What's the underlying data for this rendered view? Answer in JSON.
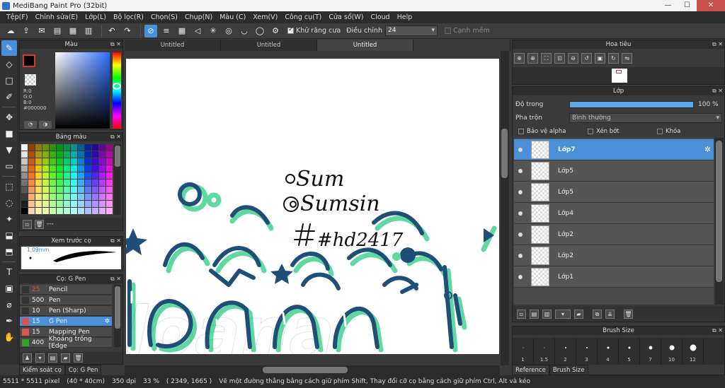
{
  "window": {
    "title": "MediBang Paint Pro (32bit)"
  },
  "menu": [
    "Tệp(F)",
    "Chỉnh sửa(E)",
    "Lớp(L)",
    "Bộ lọc(R)",
    "Chọn(S)",
    "Chụp(N)",
    "Màu (C)",
    "Xem(V)",
    "Công cụ(T)",
    "Cửa sổ(W)",
    "Cloud",
    "Help"
  ],
  "toolbar": {
    "antialias_label": "Khử răng cưa",
    "correction_label": "Điều chỉnh",
    "correction_value": "24",
    "snap_label": "Cạnh mềm"
  },
  "color_panel": {
    "title": "Màu",
    "r": "R:0",
    "g": "G:0",
    "b": "B:0",
    "hex": "#000000"
  },
  "palette_panel": {
    "title": "Bảng màu",
    "more": "---"
  },
  "preview_panel": {
    "title": "Xem trước cọ",
    "size": "1.09mm"
  },
  "brush_panel": {
    "title": "Cọ: G Pen",
    "brushes": [
      {
        "size": "25",
        "name": "Pencil",
        "color": "#d9534f"
      },
      {
        "size": "500",
        "name": "Pen",
        "color": "#222222"
      },
      {
        "size": "10",
        "name": "Pen (Sharp)",
        "color": "#222222"
      },
      {
        "size": "15",
        "name": "G Pen",
        "color": "#d9534f"
      },
      {
        "size": "15",
        "name": "Mapping Pen",
        "color": "#d9534f"
      },
      {
        "size": "400",
        "name": "Khoảng trống [Edge",
        "color": "#2aa52a"
      }
    ]
  },
  "left_tabs": [
    "Kiểm soát cọ",
    "Cọ: G Pen"
  ],
  "doc_tabs": [
    "Untitled",
    "Untitled",
    "Untitled"
  ],
  "artwork": {
    "line1": "Sum",
    "line2": "Sumsin",
    "line3": "#hd2417",
    "big_text": "loana",
    "colors": {
      "navy": "#1f4f78",
      "mint": "#5fd9a0"
    }
  },
  "nav_panel": {
    "title": "Hoa tiêu"
  },
  "layer_panel": {
    "title": "Lớp",
    "opacity_label": "Độ trong",
    "opacity_value": "100 %",
    "opacity_fraction": 1.0,
    "blend_label": "Pha trộn",
    "blend_value": "Bình thường",
    "protect_alpha": "Bảo vệ alpha",
    "clipping": "Xén bớt",
    "lock": "Khóa",
    "layers": [
      "Lớp7",
      "Lớp5",
      "Lớp5",
      "Lớp4",
      "Lớp2",
      "Lớp2",
      "Lớp1"
    ]
  },
  "brushsize_panel": {
    "title": "Brush Size",
    "sizes": [
      "1",
      "1.5",
      "2",
      "3",
      "4",
      "5",
      "7",
      "10",
      "12"
    ]
  },
  "right_tabs": [
    "Reference",
    "Brush Size"
  ],
  "status": {
    "dimensions": "5511 * 5511 pixel",
    "physical": "(40 * 40cm)",
    "dpi": "350 dpi",
    "zoom": "33 %",
    "coords": "( 2349, 1665 )",
    "hint": "Vẽ một đường thẳng bằng cách giữ phím Shift, Thay đổi cỡ cọ bằng cách giữ phím Ctrl, Alt và kéo"
  }
}
